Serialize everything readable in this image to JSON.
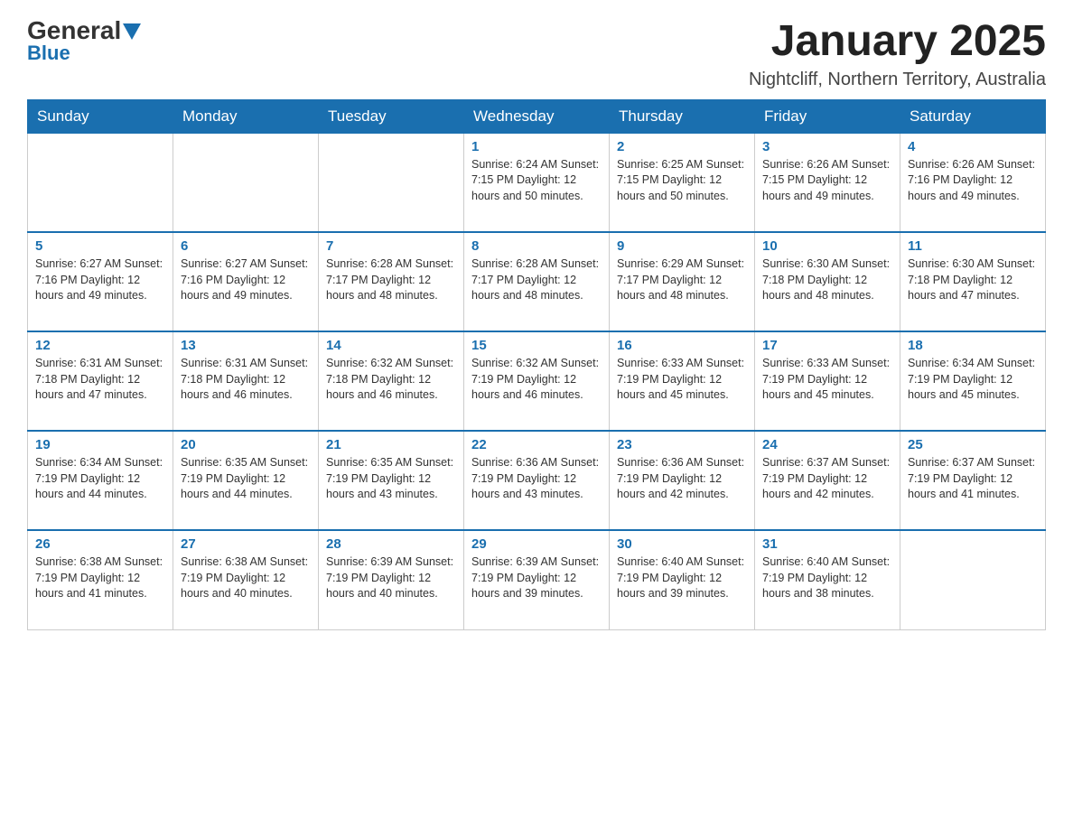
{
  "header": {
    "logo": {
      "general": "General",
      "blue": "Blue"
    },
    "title": "January 2025",
    "subtitle": "Nightcliff, Northern Territory, Australia"
  },
  "days_of_week": [
    "Sunday",
    "Monday",
    "Tuesday",
    "Wednesday",
    "Thursday",
    "Friday",
    "Saturday"
  ],
  "weeks": [
    {
      "cells": [
        {
          "day": "",
          "info": ""
        },
        {
          "day": "",
          "info": ""
        },
        {
          "day": "",
          "info": ""
        },
        {
          "day": "1",
          "info": "Sunrise: 6:24 AM\nSunset: 7:15 PM\nDaylight: 12 hours\nand 50 minutes."
        },
        {
          "day": "2",
          "info": "Sunrise: 6:25 AM\nSunset: 7:15 PM\nDaylight: 12 hours\nand 50 minutes."
        },
        {
          "day": "3",
          "info": "Sunrise: 6:26 AM\nSunset: 7:15 PM\nDaylight: 12 hours\nand 49 minutes."
        },
        {
          "day": "4",
          "info": "Sunrise: 6:26 AM\nSunset: 7:16 PM\nDaylight: 12 hours\nand 49 minutes."
        }
      ]
    },
    {
      "cells": [
        {
          "day": "5",
          "info": "Sunrise: 6:27 AM\nSunset: 7:16 PM\nDaylight: 12 hours\nand 49 minutes."
        },
        {
          "day": "6",
          "info": "Sunrise: 6:27 AM\nSunset: 7:16 PM\nDaylight: 12 hours\nand 49 minutes."
        },
        {
          "day": "7",
          "info": "Sunrise: 6:28 AM\nSunset: 7:17 PM\nDaylight: 12 hours\nand 48 minutes."
        },
        {
          "day": "8",
          "info": "Sunrise: 6:28 AM\nSunset: 7:17 PM\nDaylight: 12 hours\nand 48 minutes."
        },
        {
          "day": "9",
          "info": "Sunrise: 6:29 AM\nSunset: 7:17 PM\nDaylight: 12 hours\nand 48 minutes."
        },
        {
          "day": "10",
          "info": "Sunrise: 6:30 AM\nSunset: 7:18 PM\nDaylight: 12 hours\nand 48 minutes."
        },
        {
          "day": "11",
          "info": "Sunrise: 6:30 AM\nSunset: 7:18 PM\nDaylight: 12 hours\nand 47 minutes."
        }
      ]
    },
    {
      "cells": [
        {
          "day": "12",
          "info": "Sunrise: 6:31 AM\nSunset: 7:18 PM\nDaylight: 12 hours\nand 47 minutes."
        },
        {
          "day": "13",
          "info": "Sunrise: 6:31 AM\nSunset: 7:18 PM\nDaylight: 12 hours\nand 46 minutes."
        },
        {
          "day": "14",
          "info": "Sunrise: 6:32 AM\nSunset: 7:18 PM\nDaylight: 12 hours\nand 46 minutes."
        },
        {
          "day": "15",
          "info": "Sunrise: 6:32 AM\nSunset: 7:19 PM\nDaylight: 12 hours\nand 46 minutes."
        },
        {
          "day": "16",
          "info": "Sunrise: 6:33 AM\nSunset: 7:19 PM\nDaylight: 12 hours\nand 45 minutes."
        },
        {
          "day": "17",
          "info": "Sunrise: 6:33 AM\nSunset: 7:19 PM\nDaylight: 12 hours\nand 45 minutes."
        },
        {
          "day": "18",
          "info": "Sunrise: 6:34 AM\nSunset: 7:19 PM\nDaylight: 12 hours\nand 45 minutes."
        }
      ]
    },
    {
      "cells": [
        {
          "day": "19",
          "info": "Sunrise: 6:34 AM\nSunset: 7:19 PM\nDaylight: 12 hours\nand 44 minutes."
        },
        {
          "day": "20",
          "info": "Sunrise: 6:35 AM\nSunset: 7:19 PM\nDaylight: 12 hours\nand 44 minutes."
        },
        {
          "day": "21",
          "info": "Sunrise: 6:35 AM\nSunset: 7:19 PM\nDaylight: 12 hours\nand 43 minutes."
        },
        {
          "day": "22",
          "info": "Sunrise: 6:36 AM\nSunset: 7:19 PM\nDaylight: 12 hours\nand 43 minutes."
        },
        {
          "day": "23",
          "info": "Sunrise: 6:36 AM\nSunset: 7:19 PM\nDaylight: 12 hours\nand 42 minutes."
        },
        {
          "day": "24",
          "info": "Sunrise: 6:37 AM\nSunset: 7:19 PM\nDaylight: 12 hours\nand 42 minutes."
        },
        {
          "day": "25",
          "info": "Sunrise: 6:37 AM\nSunset: 7:19 PM\nDaylight: 12 hours\nand 41 minutes."
        }
      ]
    },
    {
      "cells": [
        {
          "day": "26",
          "info": "Sunrise: 6:38 AM\nSunset: 7:19 PM\nDaylight: 12 hours\nand 41 minutes."
        },
        {
          "day": "27",
          "info": "Sunrise: 6:38 AM\nSunset: 7:19 PM\nDaylight: 12 hours\nand 40 minutes."
        },
        {
          "day": "28",
          "info": "Sunrise: 6:39 AM\nSunset: 7:19 PM\nDaylight: 12 hours\nand 40 minutes."
        },
        {
          "day": "29",
          "info": "Sunrise: 6:39 AM\nSunset: 7:19 PM\nDaylight: 12 hours\nand 39 minutes."
        },
        {
          "day": "30",
          "info": "Sunrise: 6:40 AM\nSunset: 7:19 PM\nDaylight: 12 hours\nand 39 minutes."
        },
        {
          "day": "31",
          "info": "Sunrise: 6:40 AM\nSunset: 7:19 PM\nDaylight: 12 hours\nand 38 minutes."
        },
        {
          "day": "",
          "info": ""
        }
      ]
    }
  ]
}
